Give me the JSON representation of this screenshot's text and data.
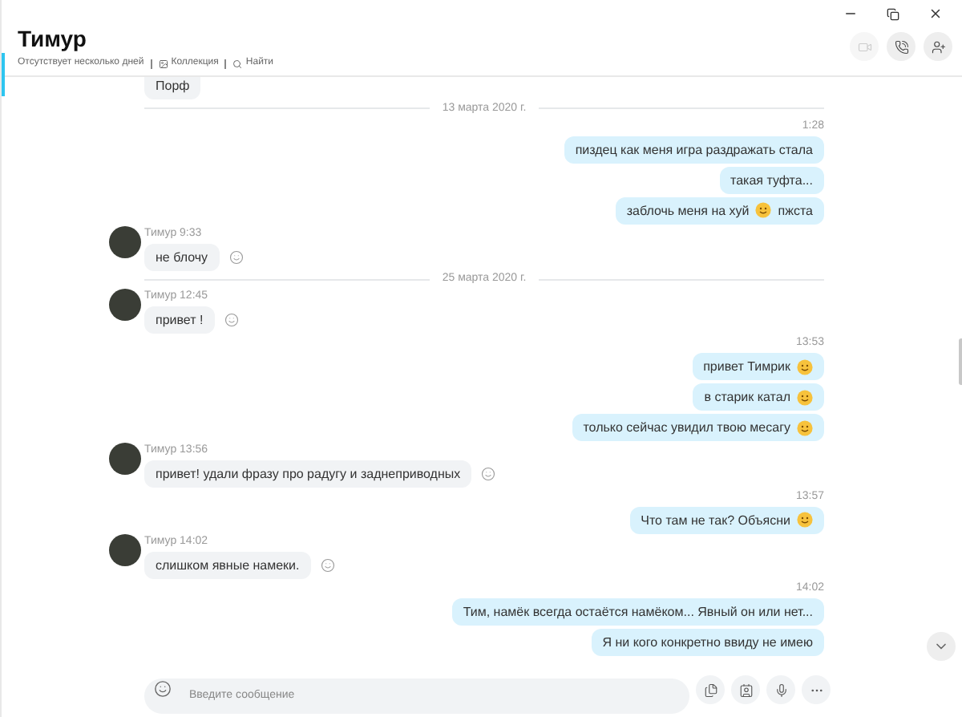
{
  "header": {
    "title": "Тимур",
    "status": "Отсутствует несколько дней",
    "links": [
      {
        "kind": "gallery",
        "label": "Коллекция"
      },
      {
        "kind": "search",
        "label": "Найти"
      }
    ],
    "buttons": [
      {
        "kind": "video",
        "disabled": true
      },
      {
        "kind": "call",
        "disabled": false
      },
      {
        "kind": "add-person",
        "disabled": false
      }
    ]
  },
  "feed": [
    {
      "kind": "in",
      "partial": true,
      "bubbles": [
        {
          "segments": [
            {
              "kind": "text",
              "text": "Порф"
            }
          ]
        }
      ]
    },
    {
      "kind": "date",
      "text": "13 марта 2020 г."
    },
    {
      "kind": "out",
      "time": "1:28",
      "bubbles": [
        {
          "segments": [
            {
              "kind": "text",
              "text": "пиздец как меня игра раздражать стала"
            }
          ]
        },
        {
          "segments": [
            {
              "kind": "text",
              "text": "такая туфта..."
            }
          ]
        },
        {
          "segments": [
            {
              "kind": "text",
              "text": "заблочь меня на хуй"
            },
            {
              "kind": "emoji"
            },
            {
              "kind": "text",
              "text": "пжста"
            }
          ]
        }
      ]
    },
    {
      "kind": "in",
      "sender": "Тимур 9:33",
      "bubbles": [
        {
          "segments": [
            {
              "kind": "text",
              "text": "не блочу"
            }
          ]
        }
      ]
    },
    {
      "kind": "date",
      "text": "25 марта 2020 г."
    },
    {
      "kind": "in",
      "sender": "Тимур 12:45",
      "bubbles": [
        {
          "segments": [
            {
              "kind": "text",
              "text": "привет !"
            }
          ]
        }
      ]
    },
    {
      "kind": "out",
      "time": "13:53",
      "bubbles": [
        {
          "segments": [
            {
              "kind": "text",
              "text": "привет Тимрик"
            },
            {
              "kind": "emoji"
            }
          ]
        },
        {
          "segments": [
            {
              "kind": "text",
              "text": "в старик катал"
            },
            {
              "kind": "emoji"
            }
          ]
        },
        {
          "segments": [
            {
              "kind": "text",
              "text": "только сейчас увидил твою месагу"
            },
            {
              "kind": "emoji"
            }
          ]
        }
      ]
    },
    {
      "kind": "in",
      "sender": "Тимур 13:56",
      "bubbles": [
        {
          "segments": [
            {
              "kind": "text",
              "text": "привет! удали фразу про радугу и заднеприводных"
            }
          ]
        }
      ]
    },
    {
      "kind": "out",
      "time": "13:57",
      "bubbles": [
        {
          "segments": [
            {
              "kind": "text",
              "text": "Что там не так? Объясни"
            },
            {
              "kind": "emoji"
            }
          ]
        }
      ]
    },
    {
      "kind": "in",
      "sender": "Тимур 14:02",
      "bubbles": [
        {
          "segments": [
            {
              "kind": "text",
              "text": "слишком явные намеки."
            }
          ]
        }
      ]
    },
    {
      "kind": "out",
      "time": "14:02",
      "bubbles": [
        {
          "segments": [
            {
              "kind": "text",
              "text": "Тим, намёк всегда остаётся намёком... Явный он или нет..."
            }
          ]
        },
        {
          "segments": [
            {
              "kind": "text",
              "text": "Я ни кого конкретно ввиду не имею"
            }
          ]
        }
      ]
    }
  ],
  "composer": {
    "placeholder": "Введите сообщение"
  }
}
